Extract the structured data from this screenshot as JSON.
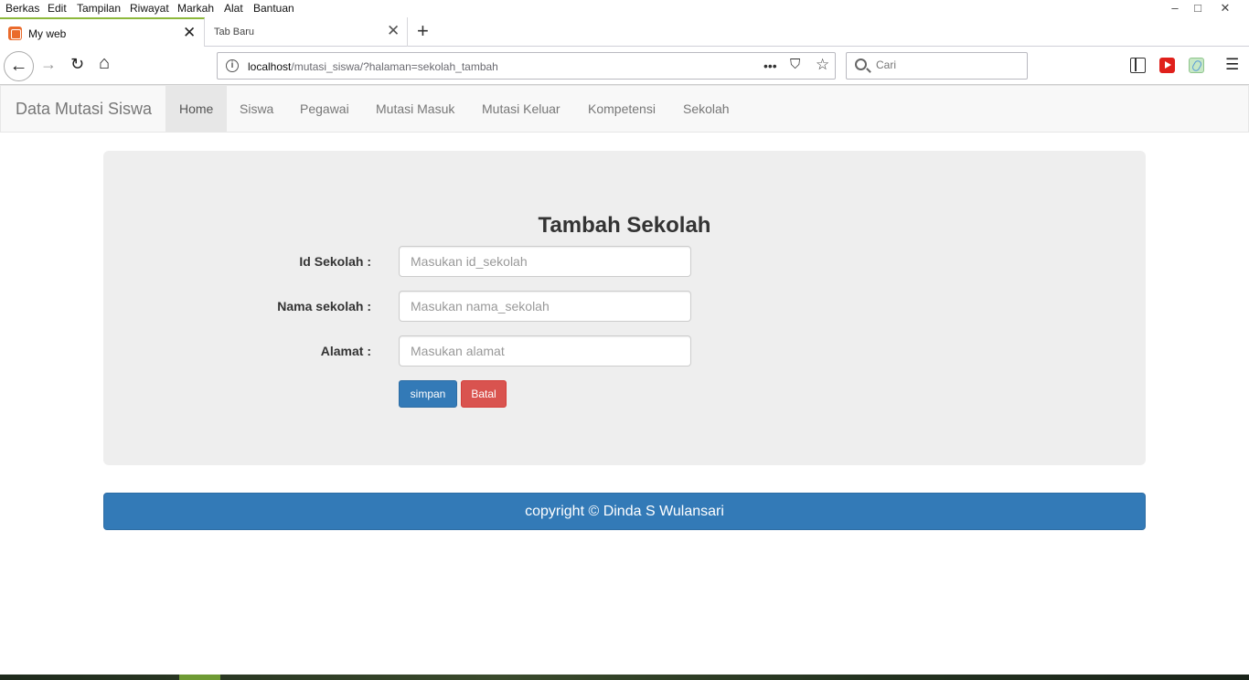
{
  "browser": {
    "menu": [
      "Berkas",
      "Edit",
      "Tampilan",
      "Riwayat",
      "Markah",
      "Alat",
      "Bantuan"
    ],
    "window_controls": [
      "–",
      "□",
      "✕"
    ],
    "tabs": [
      {
        "title": "My web",
        "close": "✕"
      },
      {
        "title": "Tab Baru",
        "close": "✕"
      }
    ],
    "new_tab": "+",
    "url": {
      "host": "localhost",
      "path": "/mutasi_siswa/?halaman=sekolah_tambah"
    },
    "url_actions": [
      "•••",
      "⛉",
      "☆"
    ],
    "search_placeholder": "Cari",
    "nav": {
      "back": "←",
      "forward": "→",
      "reload": "↻",
      "home": "⌂"
    },
    "menu_glyph": "☰"
  },
  "site": {
    "brand": "Data Mutasi Siswa",
    "nav_items": [
      "Home",
      "Siswa",
      "Pegawai",
      "Mutasi Masuk",
      "Mutasi Keluar",
      "Kompetensi",
      "Sekolah"
    ],
    "active_nav": "Home"
  },
  "form": {
    "title": "Tambah Sekolah",
    "fields": [
      {
        "label": "Id Sekolah :",
        "placeholder": "Masukan id_sekolah",
        "value": ""
      },
      {
        "label": "Nama sekolah :",
        "placeholder": "Masukan nama_sekolah",
        "value": ""
      },
      {
        "label": "Alamat :",
        "placeholder": "Masukan alamat",
        "value": ""
      }
    ],
    "submit_label": "simpan",
    "cancel_label": "Batal"
  },
  "footer": {
    "text": "copyright © Dinda S Wulansari"
  },
  "colors": {
    "primary": "#337ab7",
    "danger": "#d9534f",
    "panel": "#eeeeee",
    "active_tab_accent": "#8db83c"
  }
}
